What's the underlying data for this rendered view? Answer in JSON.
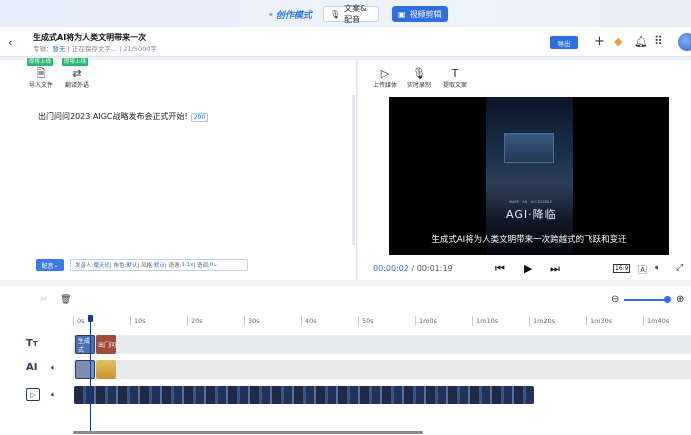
{
  "topbar": {
    "mode_label": "创作模式",
    "tab_text_audio": "文案&配音",
    "tab_video_edit": "视频剪辑"
  },
  "header": {
    "title": "生成式AI将为人类文明带来一次",
    "meta_prefix": "专辑：",
    "meta_album": "暂无",
    "meta_saving": "正在保存文字...",
    "meta_count": "21/5000字",
    "export_label": "导出"
  },
  "left_toolbar": {
    "badge1": "即将上线",
    "badge2": "即将上线",
    "import_label": "导入文件",
    "translate_label": "翻译外语"
  },
  "editor": {
    "text": "出门问问2023 AIGC战略发布会正式开始!",
    "word_count": "200"
  },
  "voice_bar": {
    "button_label": "配音",
    "settings_prefix": "发音人:",
    "speaker": "魔天轮",
    "role_prefix": "| 角色:",
    "role": "默认",
    "style_prefix": "| 风格:",
    "style": "默认",
    "speed_prefix": "| 语速:",
    "speed": "1.1x",
    "tone_prefix": "| 语调:",
    "tone": "0"
  },
  "right_toolbar": {
    "upload_label": "上传媒体",
    "record_label": "实时录制",
    "script_label": "提取文案"
  },
  "player": {
    "subtitle": "生成式AI将为人类文明带来一次跨越式的飞跃和变迁",
    "poster_small": "MAKE · AN · ACCESSIBLE",
    "poster_title": "AGI·降临",
    "current_time": "00:00:02",
    "total_time": "00:01:19",
    "ratio": "16:9"
  },
  "timeline": {
    "ticks": [
      "0s",
      "10s",
      "20s",
      "30s",
      "40s",
      "50s",
      "1m0s",
      "1m10s",
      "1m20s",
      "1m30s",
      "1m40s"
    ],
    "clip1_label": "生成式",
    "clip2_label": "出门问",
    "track_text_label": "TT",
    "track_ai_label": "AI"
  },
  "colors": {
    "accent": "#2f6fe0",
    "text_clip_blue": "#4d6db0",
    "text_clip_red": "#a04a3a",
    "audio_clip": "#d8a640"
  }
}
